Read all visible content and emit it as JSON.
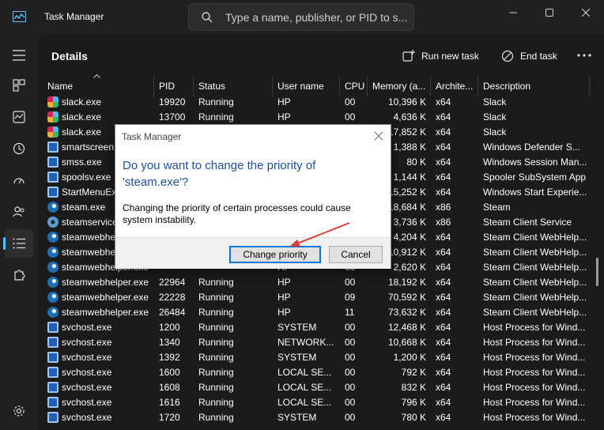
{
  "titlebar": {
    "title": "Task Manager",
    "search_placeholder": "Type a name, publisher, or PID to s..."
  },
  "page": {
    "title": "Details",
    "run_new_task": "Run new task",
    "end_task": "End task"
  },
  "table": {
    "columns": [
      "Name",
      "PID",
      "Status",
      "User name",
      "CPU",
      "Memory (a...",
      "Archite...",
      "Description"
    ],
    "rows": [
      {
        "icon": "slack",
        "name": "slack.exe",
        "pid": "19920",
        "status": "Running",
        "user": "HP",
        "cpu": "00",
        "mem": "10,396 K",
        "arch": "x64",
        "desc": "Slack"
      },
      {
        "icon": "slack",
        "name": "slack.exe",
        "pid": "13700",
        "status": "Running",
        "user": "HP",
        "cpu": "00",
        "mem": "4,636 K",
        "arch": "x64",
        "desc": "Slack"
      },
      {
        "icon": "slack",
        "name": "slack.exe",
        "pid": "",
        "status": "",
        "user": "",
        "cpu": "",
        "mem": "17,852 K",
        "arch": "x64",
        "desc": "Slack"
      },
      {
        "icon": "win",
        "name": "smartscreen.e",
        "pid": "",
        "status": "",
        "user": "",
        "cpu": "",
        "mem": "1,388 K",
        "arch": "x64",
        "desc": "Windows Defender S..."
      },
      {
        "icon": "win",
        "name": "smss.exe",
        "pid": "",
        "status": "",
        "user": "",
        "cpu": "",
        "mem": "80 K",
        "arch": "x64",
        "desc": "Windows Session Man..."
      },
      {
        "icon": "win",
        "name": "spoolsv.exe",
        "pid": "",
        "status": "",
        "user": "",
        "cpu": "",
        "mem": "1,144 K",
        "arch": "x64",
        "desc": "Spooler SubSystem App"
      },
      {
        "icon": "win",
        "name": "StartMenuExp",
        "pid": "",
        "status": "",
        "user": "",
        "cpu": "",
        "mem": "15,252 K",
        "arch": "x64",
        "desc": "Windows Start Experie..."
      },
      {
        "icon": "steam",
        "name": "steam.exe",
        "pid": "",
        "status": "",
        "user": "",
        "cpu": "",
        "mem": "18,684 K",
        "arch": "x86",
        "desc": "Steam"
      },
      {
        "icon": "gear",
        "name": "steamservice.e",
        "pid": "",
        "status": "",
        "user": "",
        "cpu": "",
        "mem": "3,736 K",
        "arch": "x86",
        "desc": "Steam Client Service"
      },
      {
        "icon": "steam",
        "name": "steamwebhel",
        "pid": "",
        "status": "",
        "user": "",
        "cpu": "",
        "mem": "4,204 K",
        "arch": "x64",
        "desc": "Steam Client WebHelp..."
      },
      {
        "icon": "steam",
        "name": "steamwebhel",
        "pid": "",
        "status": "",
        "user": "",
        "cpu": "",
        "mem": "10,912 K",
        "arch": "x64",
        "desc": "Steam Client WebHelp..."
      },
      {
        "icon": "steam",
        "name": "steamwebhelper.exe",
        "pid": "",
        "status": "",
        "user": "HP",
        "cpu": "00",
        "mem": "2,620 K",
        "arch": "x64",
        "desc": "Steam Client WebHelp..."
      },
      {
        "icon": "steam",
        "name": "steamwebhelper.exe",
        "pid": "22964",
        "status": "Running",
        "user": "HP",
        "cpu": "00",
        "mem": "18,192 K",
        "arch": "x64",
        "desc": "Steam Client WebHelp..."
      },
      {
        "icon": "steam",
        "name": "steamwebhelper.exe",
        "pid": "22228",
        "status": "Running",
        "user": "HP",
        "cpu": "09",
        "mem": "70,592 K",
        "arch": "x64",
        "desc": "Steam Client WebHelp..."
      },
      {
        "icon": "steam",
        "name": "steamwebhelper.exe",
        "pid": "26484",
        "status": "Running",
        "user": "HP",
        "cpu": "11",
        "mem": "73,632 K",
        "arch": "x64",
        "desc": "Steam Client WebHelp..."
      },
      {
        "icon": "win",
        "name": "svchost.exe",
        "pid": "1200",
        "status": "Running",
        "user": "SYSTEM",
        "cpu": "00",
        "mem": "12,468 K",
        "arch": "x64",
        "desc": "Host Process for Wind..."
      },
      {
        "icon": "win",
        "name": "svchost.exe",
        "pid": "1340",
        "status": "Running",
        "user": "NETWORK...",
        "cpu": "00",
        "mem": "10,668 K",
        "arch": "x64",
        "desc": "Host Process for Wind..."
      },
      {
        "icon": "win",
        "name": "svchost.exe",
        "pid": "1392",
        "status": "Running",
        "user": "SYSTEM",
        "cpu": "00",
        "mem": "1,200 K",
        "arch": "x64",
        "desc": "Host Process for Wind..."
      },
      {
        "icon": "win",
        "name": "svchost.exe",
        "pid": "1600",
        "status": "Running",
        "user": "LOCAL SE...",
        "cpu": "00",
        "mem": "792 K",
        "arch": "x64",
        "desc": "Host Process for Wind..."
      },
      {
        "icon": "win",
        "name": "svchost.exe",
        "pid": "1608",
        "status": "Running",
        "user": "LOCAL SE...",
        "cpu": "00",
        "mem": "832 K",
        "arch": "x64",
        "desc": "Host Process for Wind..."
      },
      {
        "icon": "win",
        "name": "svchost.exe",
        "pid": "1616",
        "status": "Running",
        "user": "LOCAL SE...",
        "cpu": "00",
        "mem": "796 K",
        "arch": "x64",
        "desc": "Host Process for Wind..."
      },
      {
        "icon": "win",
        "name": "svchost.exe",
        "pid": "1720",
        "status": "Running",
        "user": "SYSTEM",
        "cpu": "00",
        "mem": "780 K",
        "arch": "x64",
        "desc": "Host Process for Wind..."
      }
    ]
  },
  "dialog": {
    "title": "Task Manager",
    "question": "Do you want to change the priority of 'steam.exe'?",
    "message": "Changing the priority of certain processes could cause system instability.",
    "confirm": "Change priority",
    "cancel": "Cancel"
  },
  "colors": {
    "accent": "#4cc2ff",
    "dialog_heading": "#1d4fa3",
    "annotation_arrow": "#d9403a"
  }
}
